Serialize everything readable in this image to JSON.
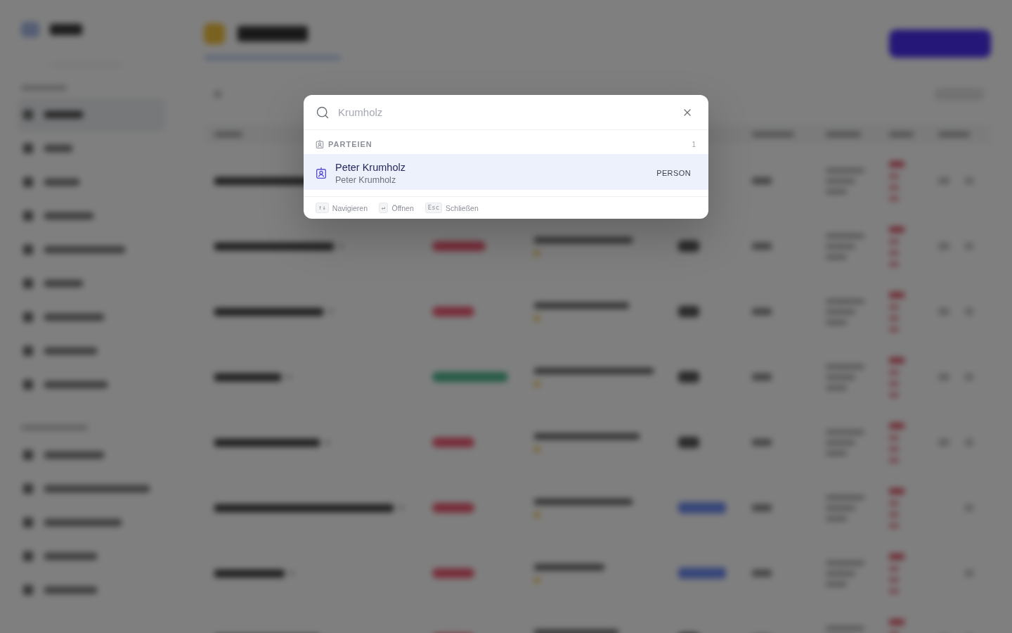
{
  "search_dialog": {
    "query": "Krumholz",
    "sections": [
      {
        "title": "PARTEIEN",
        "count": "1",
        "results": [
          {
            "title": "Peter Krumholz",
            "subtitle": "Peter Krumholz",
            "tag": "PERSON",
            "selected": true
          }
        ]
      }
    ],
    "shortcuts": [
      {
        "key": "↑↓",
        "label": "Navigieren"
      },
      {
        "key": "↵",
        "label": "Öffnen"
      },
      {
        "key": "Esc",
        "label": "Schließen"
      }
    ]
  }
}
